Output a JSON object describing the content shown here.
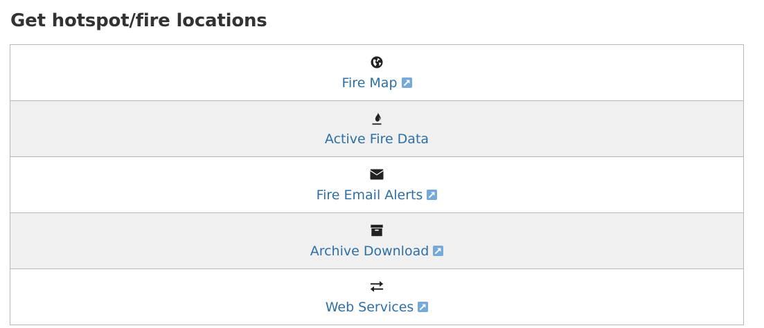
{
  "page": {
    "title": "Get hotspot/fire locations"
  },
  "items": [
    {
      "label": "Fire Map",
      "icon": "globe-icon",
      "external": true
    },
    {
      "label": "Active Fire Data",
      "icon": "fire-icon",
      "external": false
    },
    {
      "label": "Fire Email Alerts",
      "icon": "envelope-icon",
      "external": true
    },
    {
      "label": "Archive Download",
      "icon": "archive-box-icon",
      "external": true
    },
    {
      "label": "Web Services",
      "icon": "exchange-arrows-icon",
      "external": true
    }
  ],
  "colors": {
    "link": "#2e6fa3",
    "external_icon": "#74a9d8",
    "alt_row": "#f0f0f0",
    "border": "#b7b7b7",
    "icon": "#222222"
  }
}
